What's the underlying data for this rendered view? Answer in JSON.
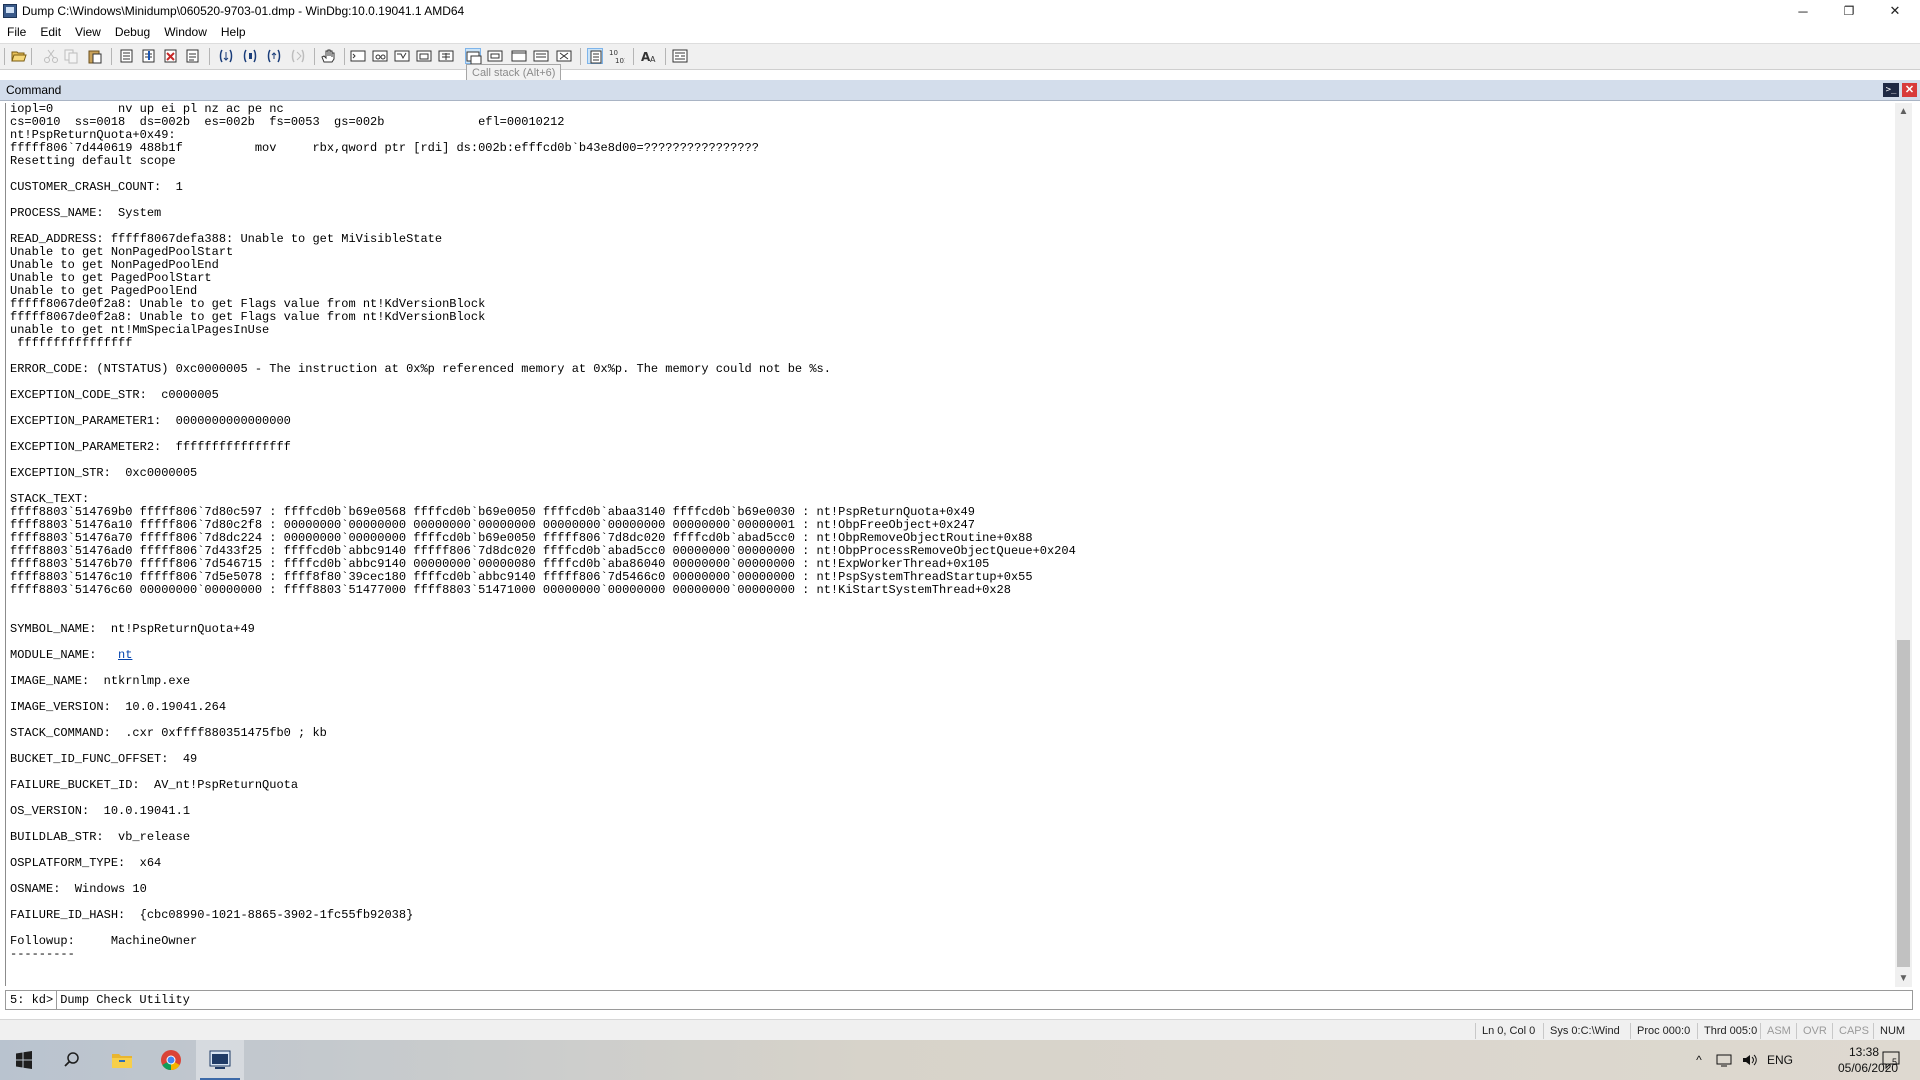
{
  "window": {
    "title": "Dump C:\\Windows\\Minidump\\060520-9703-01.dmp - WinDbg:10.0.19041.1 AMD64",
    "controls": {
      "minimize": "─",
      "maximize": "❐",
      "close": "✕"
    }
  },
  "menu": [
    "File",
    "Edit",
    "View",
    "Debug",
    "Window",
    "Help"
  ],
  "toolbar": {
    "tooltip": "Call stack (Alt+6)",
    "icons": [
      "open-icon",
      "cut-icon",
      "copy-icon",
      "paste-icon",
      "insert-breakpoint-icon",
      "step-into-icon",
      "step-over-icon",
      "step-out-icon",
      "run-to-cursor-icon",
      "break-icon",
      "restart-icon",
      "stop-debugging-icon",
      "hand-icon",
      "command-window-icon",
      "watch-window-icon",
      "locals-window-icon",
      "registers-window-icon",
      "memory-window-icon",
      "call-stack-icon",
      "disassembly-icon",
      "scratch-pad-icon",
      "processes-threads-icon",
      "source-mode-icon",
      "hex-mode-icon",
      "font-icon",
      "options-icon"
    ]
  },
  "command_window": {
    "title": "Command",
    "output": "iopl=0         nv up ei pl nz ac pe nc\ncs=0010  ss=0018  ds=002b  es=002b  fs=0053  gs=002b             efl=00010212\nnt!PspReturnQuota+0x49:\nfffff806`7d440619 488b1f          mov     rbx,qword ptr [rdi] ds:002b:efffcd0b`b43e8d00=????????????????\nResetting default scope\n\nCUSTOMER_CRASH_COUNT:  1\n\nPROCESS_NAME:  System\n\nREAD_ADDRESS: fffff8067defa388: Unable to get MiVisibleState\nUnable to get NonPagedPoolStart\nUnable to get NonPagedPoolEnd\nUnable to get PagedPoolStart\nUnable to get PagedPoolEnd\nfffff8067de0f2a8: Unable to get Flags value from nt!KdVersionBlock\nfffff8067de0f2a8: Unable to get Flags value from nt!KdVersionBlock\nunable to get nt!MmSpecialPagesInUse\n ffffffffffffffff\n\nERROR_CODE: (NTSTATUS) 0xc0000005 - The instruction at 0x%p referenced memory at 0x%p. The memory could not be %s.\n\nEXCEPTION_CODE_STR:  c0000005\n\nEXCEPTION_PARAMETER1:  0000000000000000\n\nEXCEPTION_PARAMETER2:  ffffffffffffffff\n\nEXCEPTION_STR:  0xc0000005\n\nSTACK_TEXT:\nffff8803`514769b0 fffff806`7d80c597 : ffffcd0b`b69e0568 ffffcd0b`b69e0050 ffffcd0b`abaa3140 ffffcd0b`b69e0030 : nt!PspReturnQuota+0x49\nffff8803`51476a10 fffff806`7d80c2f8 : 00000000`00000000 00000000`00000000 00000000`00000000 00000000`00000001 : nt!ObpFreeObject+0x247\nffff8803`51476a70 fffff806`7d8dc224 : 00000000`00000000 ffffcd0b`b69e0050 fffff806`7d8dc020 ffffcd0b`abad5cc0 : nt!ObpRemoveObjectRoutine+0x88\nffff8803`51476ad0 fffff806`7d433f25 : ffffcd0b`abbc9140 fffff806`7d8dc020 ffffcd0b`abad5cc0 00000000`00000000 : nt!ObpProcessRemoveObjectQueue+0x204\nffff8803`51476b70 fffff806`7d546715 : ffffcd0b`abbc9140 00000000`00000080 ffffcd0b`aba86040 00000000`00000000 : nt!ExpWorkerThread+0x105\nffff8803`51476c10 fffff806`7d5e5078 : ffff8f80`39cec180 ffffcd0b`abbc9140 fffff806`7d5466c0 00000000`00000000 : nt!PspSystemThreadStartup+0x55\nffff8803`51476c60 00000000`00000000 : ffff8803`51477000 ffff8803`51471000 00000000`00000000 00000000`00000000 : nt!KiStartSystemThread+0x28\n\n\nSYMBOL_NAME:  nt!PspReturnQuota+49\n\nMODULE_NAME: \n\nIMAGE_NAME:  ntkrnlmp.exe\n\nIMAGE_VERSION:  10.0.19041.264\n\nSTACK_COMMAND:  .cxr 0xffff880351475fb0 ; kb\n\nBUCKET_ID_FUNC_OFFSET:  49\n\nFAILURE_BUCKET_ID:  AV_nt!PspReturnQuota\n\nOS_VERSION:  10.0.19041.1\n\nBUILDLAB_STR:  vb_release\n\nOSPLATFORM_TYPE:  x64\n\nOSNAME:  Windows 10\n\nFAILURE_ID_HASH:  {cbc08990-1021-8865-3902-1fc55fb92038}\n\nFollowup:     MachineOwner\n---------",
    "module_link": "nt",
    "prompt": "5: kd>",
    "input_value": "Dump Check Utility "
  },
  "statusbar": {
    "position": "Ln 0, Col 0",
    "system": "Sys 0:C:\\Wind",
    "process": "Proc 000:0",
    "thread": "Thrd 005:0",
    "asm": "ASM",
    "ovr": "OVR",
    "caps": "CAPS",
    "num": "NUM"
  },
  "taskbar": {
    "apps": [
      "windows-start-icon",
      "search-icon",
      "file-explorer-icon",
      "chrome-icon",
      "windbg-icon"
    ],
    "tray": {
      "chevron": "^",
      "language": "ENG",
      "time": "13:38",
      "date": "05/06/2020",
      "notifications": "5"
    }
  },
  "colors": {
    "header": "#d3ddeb",
    "close": "#d83b3b",
    "link": "#0645ad"
  }
}
